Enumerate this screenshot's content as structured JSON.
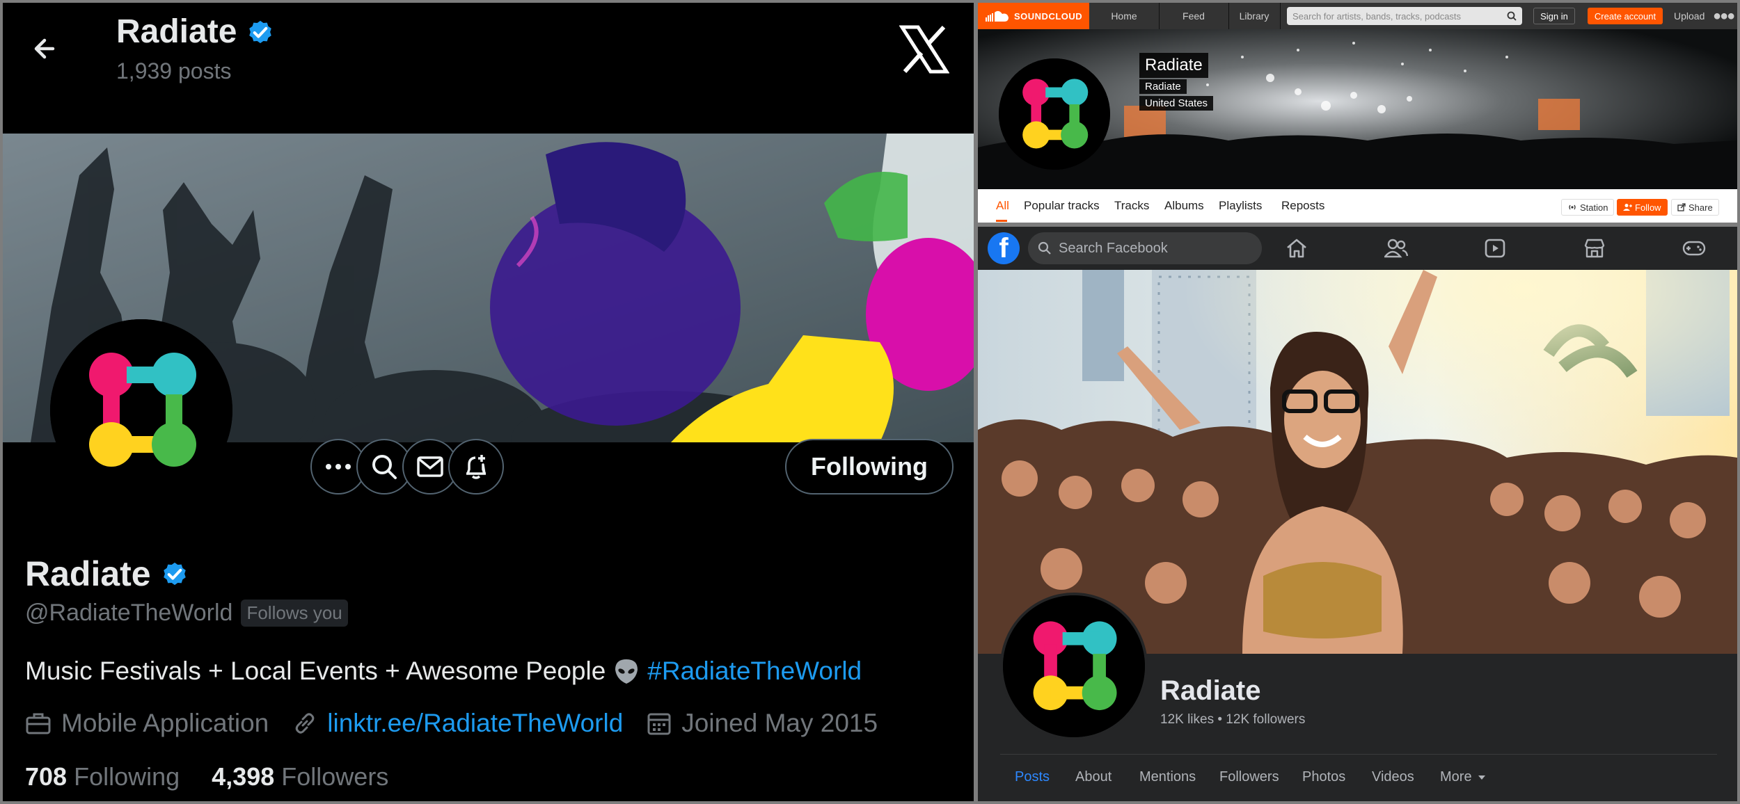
{
  "twitter": {
    "header": {
      "name": "Radiate",
      "posts": "1,939 posts"
    },
    "actions": {
      "following_label": "Following"
    },
    "profile": {
      "name": "Radiate",
      "handle": "@RadiateTheWorld",
      "follows_you": "Follows you",
      "bio_text": "Music Festivals + Local Events + Awesome People",
      "bio_hashtag": "#RadiateTheWorld",
      "category": "Mobile Application",
      "link": "linktr.ee/RadiateTheWorld",
      "joined": "Joined May 2015",
      "following_count": "708",
      "following_label": "Following",
      "followers_count": "4,398",
      "followers_label": "Followers"
    },
    "colors": {
      "accent": "#1d9bf0",
      "muted": "#71767b",
      "verified": "#1d9bf0"
    }
  },
  "soundcloud": {
    "nav": {
      "brand": "SOUNDCLOUD",
      "home": "Home",
      "feed": "Feed",
      "library": "Library",
      "search_placeholder": "Search for artists, bands, tracks, podcasts",
      "sign_in": "Sign in",
      "create_account": "Create account",
      "upload": "Upload"
    },
    "profile": {
      "name": "Radiate",
      "subtitle": "Radiate",
      "location": "United States"
    },
    "tabs": [
      "All",
      "Popular tracks",
      "Tracks",
      "Albums",
      "Playlists",
      "Reposts"
    ],
    "buttons": {
      "station": "Station",
      "follow": "Follow",
      "share": "Share"
    },
    "colors": {
      "accent": "#ff5500"
    }
  },
  "facebook": {
    "search_placeholder": "Search Facebook",
    "nav_icons": [
      "home-icon",
      "friends-icon",
      "watch-icon",
      "marketplace-icon",
      "gaming-icon"
    ],
    "page": {
      "name": "Radiate",
      "stats": "12K likes • 12K followers"
    },
    "tabs": [
      "Posts",
      "About",
      "Mentions",
      "Followers",
      "Photos",
      "Videos",
      "More"
    ],
    "colors": {
      "accent": "#2d88ff",
      "brand": "#1877f2"
    }
  }
}
